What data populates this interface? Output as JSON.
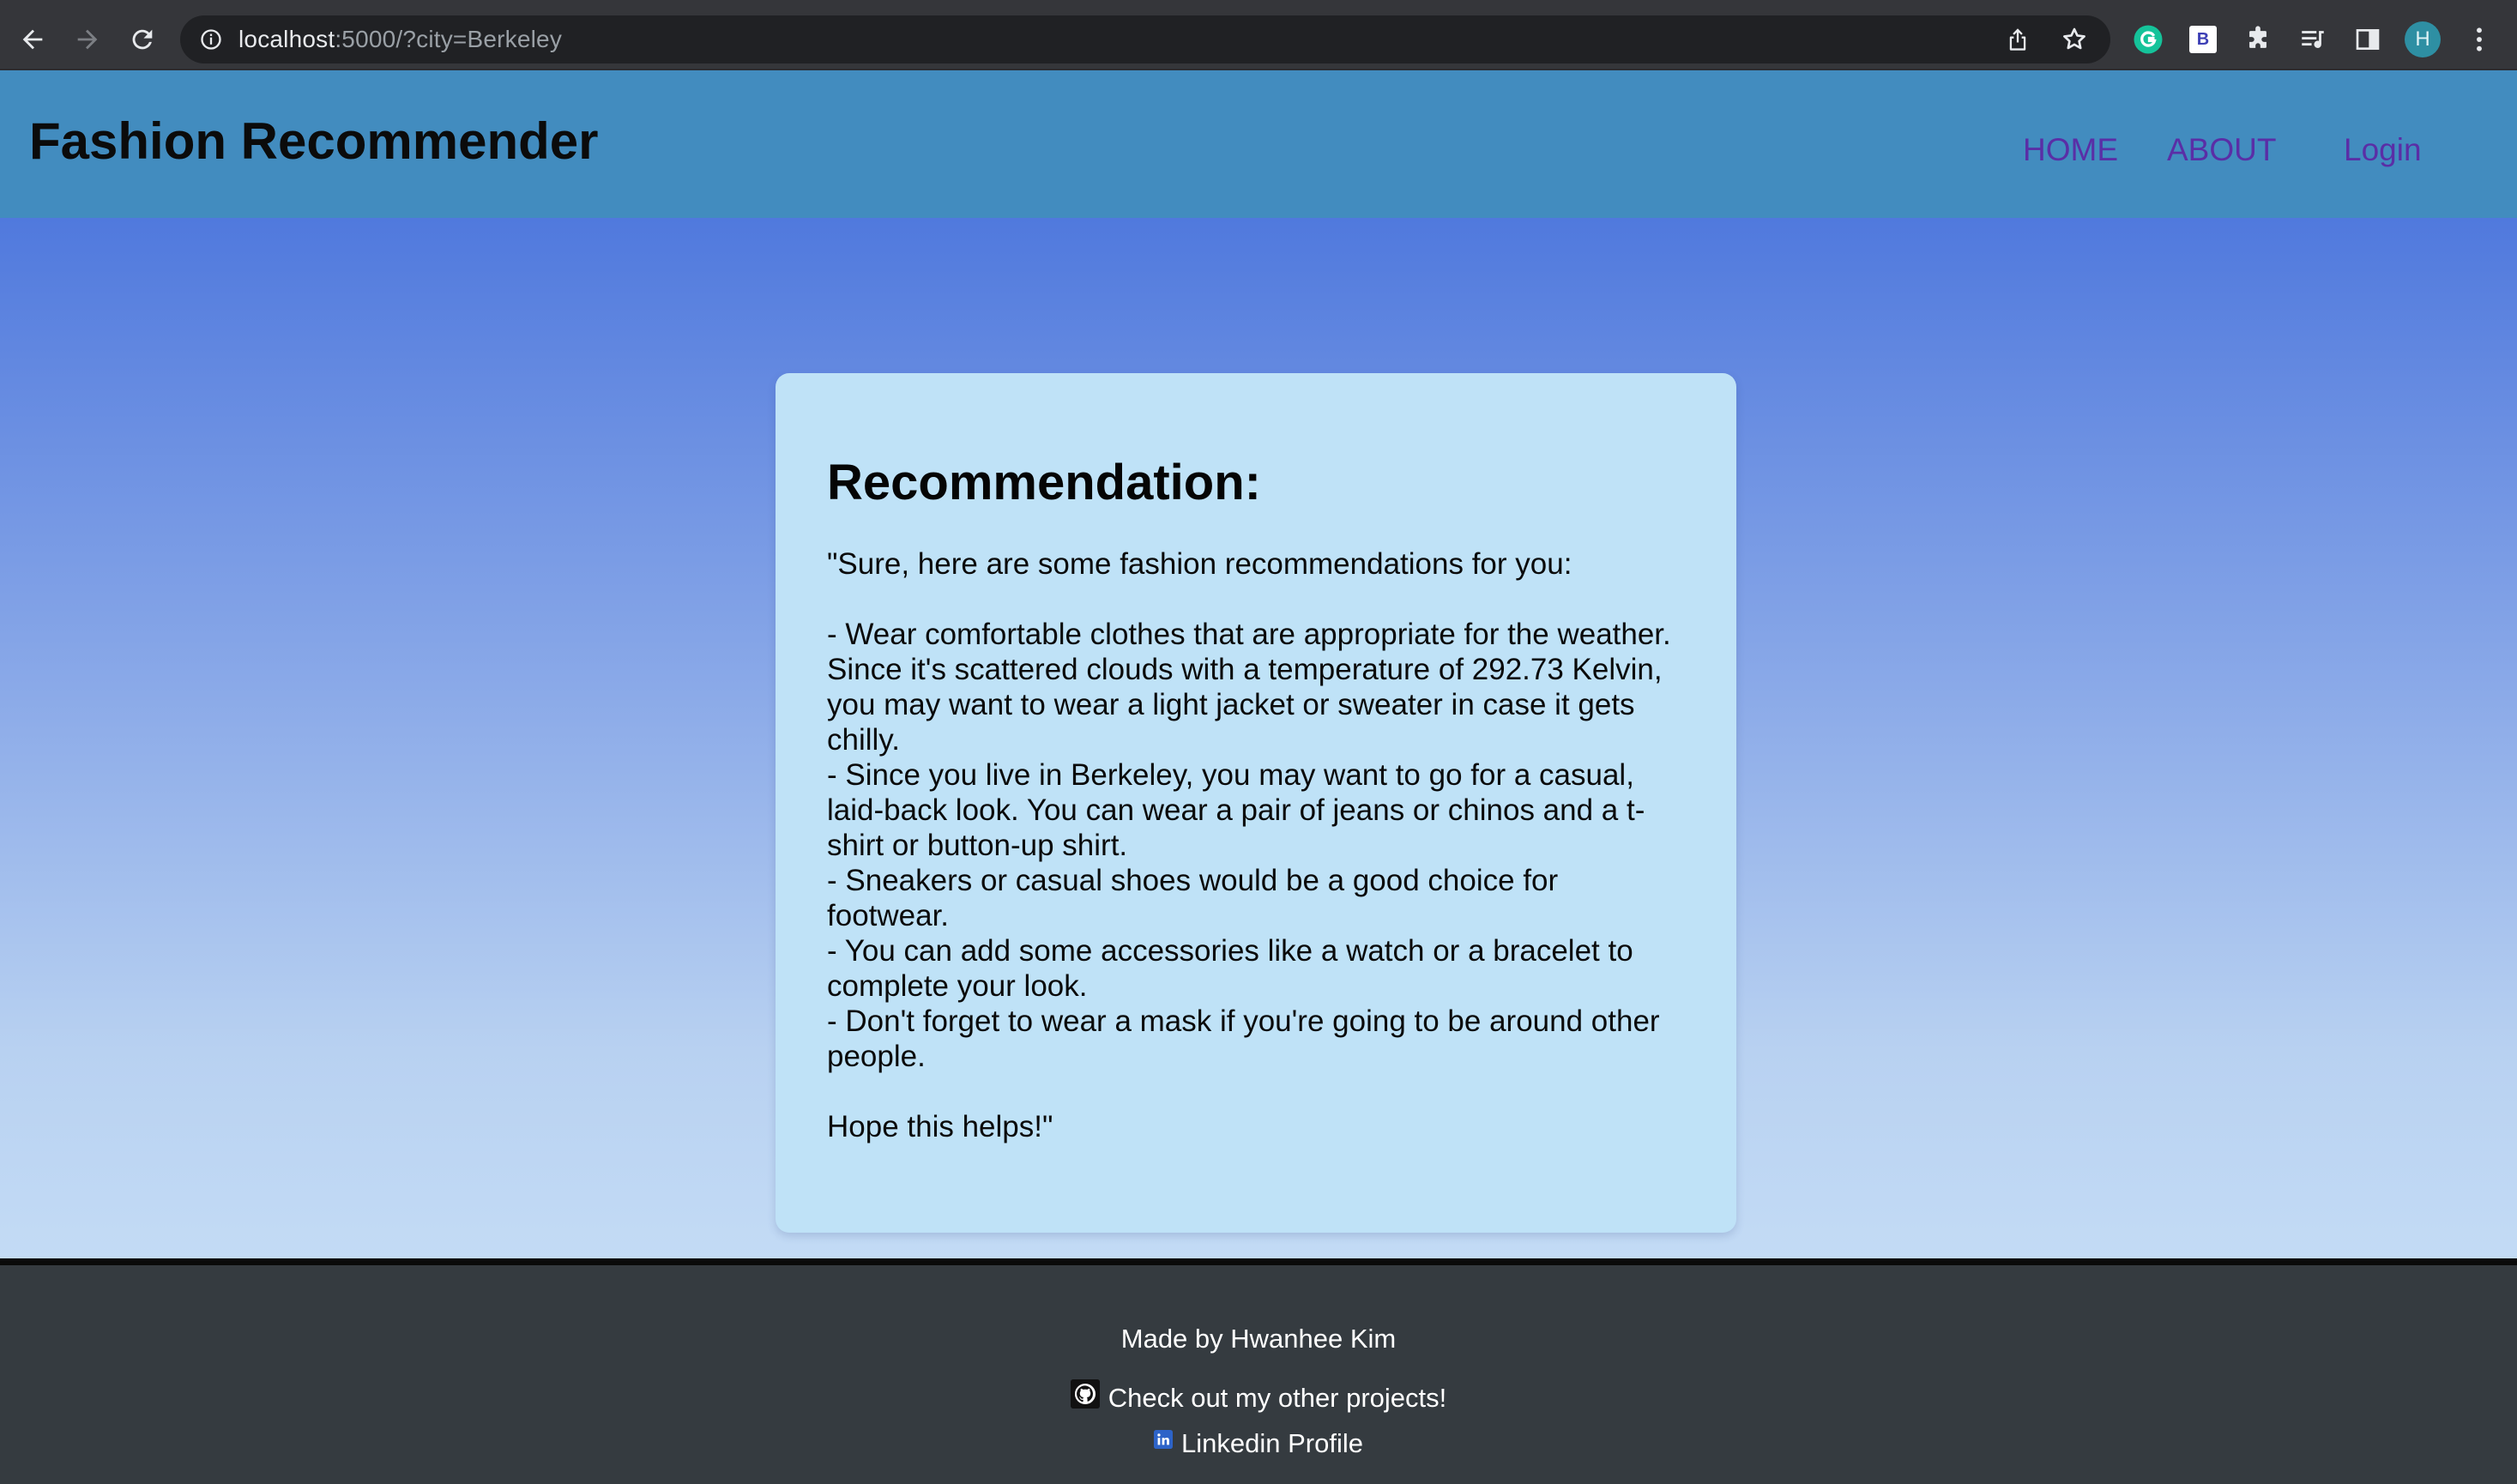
{
  "browser": {
    "url_host": "localhost",
    "url_rest": ":5000/?city=Berkeley",
    "profile_initial": "H",
    "extension_b_label": "B"
  },
  "header": {
    "title": "Fashion Recommender",
    "nav": {
      "home": "HOME",
      "about": "ABOUT",
      "login": "Login"
    }
  },
  "recommendation": {
    "heading": "Recommendation:",
    "text": "\"Sure, here are some fashion recommendations for you:\n\n- Wear comfortable clothes that are appropriate for the weather. Since it's scattered clouds with a temperature of 292.73 Kelvin, you may want to wear a light jacket or sweater in case it gets chilly.\n- Since you live in Berkeley, you may want to go for a casual, laid-back look. You can wear a pair of jeans or chinos and a t-shirt or button-up shirt.\n- Sneakers or casual shoes would be a good choice for footwear.\n- You can add some accessories like a watch or a bracelet to complete your look.\n- Don't forget to wear a mask if you're going to be around other people.\n\nHope this helps!\""
  },
  "footer": {
    "made_by": "Made by Hwanhee Kim",
    "projects_link": "Check out my other projects!",
    "linkedin_link": "Linkedin Profile"
  },
  "colors": {
    "header_bg": "#428cbf",
    "nav_link": "#5a2ea6",
    "card_bg": "#bfe2f7",
    "footer_bg": "#353b40"
  }
}
